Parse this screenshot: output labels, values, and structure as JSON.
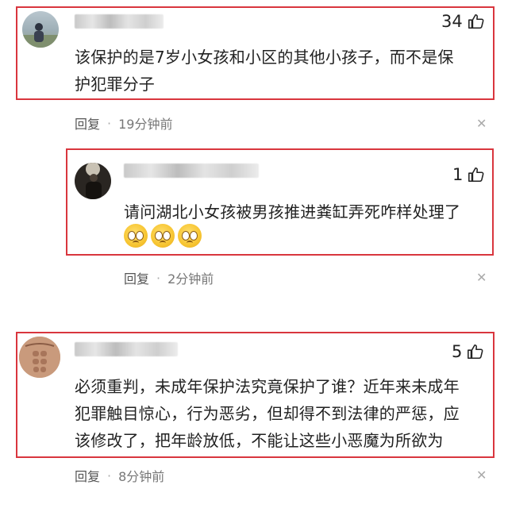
{
  "comments": [
    {
      "likes": "34",
      "text_lines": [
        "该保护的是7岁小女孩和小区的其他小孩子，而不是保",
        "护犯罪分子"
      ],
      "reply_label": "回复",
      "time": "19分钟前",
      "avatar_icon": "person-outdoor-avatar"
    },
    {
      "likes": "1",
      "text_lines": [
        "请问湖北小女孩被男孩推进粪缸弄死咋样处理了"
      ],
      "emojis": [
        "crying-face-icon",
        "crying-face-icon",
        "crying-face-icon"
      ],
      "reply_label": "回复",
      "time": "2分钟前",
      "avatar_icon": "person-dark-avatar"
    },
    {
      "likes": "5",
      "text_lines": [
        "必须重判，未成年保护法究竟保护了谁？近年来未成年",
        "犯罪触目惊心，行为恶劣，但却得不到法律的严惩，应",
        "该修改了，把年龄放低，不能让这些小恶魔为所欲为"
      ],
      "reply_label": "回复",
      "time": "8分钟前",
      "avatar_icon": "torso-avatar"
    }
  ],
  "colors": {
    "highlight_border": "#d9363e",
    "text": "#222222",
    "meta_text": "#777777"
  },
  "icons": {
    "like": "thumbs-up-icon",
    "close": "close-icon",
    "separator": "·"
  }
}
